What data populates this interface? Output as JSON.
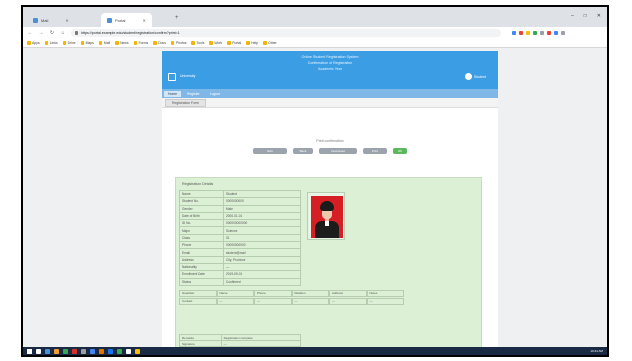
{
  "browser": {
    "tabs": [
      {
        "label": "Mail"
      },
      {
        "label": "Portal",
        "active": true
      }
    ],
    "new_tab_symbol": "+",
    "window_controls": {
      "minimize": "–",
      "maximize": "□",
      "close": "✕"
    },
    "nav": {
      "back": "←",
      "forward": "→",
      "reload": "↻",
      "home": "⌂"
    },
    "address_url": "https://portal.example.edu/student/registration/confirm?print=1",
    "extension_colors": [
      "#4285f4",
      "#ea4335",
      "#fbbc05",
      "#34a853",
      "#9aa0a6",
      "#ea4335",
      "#4285f4",
      "#9aa0a6"
    ],
    "bookmarks": [
      "Apps",
      "Links",
      "Drive",
      "Maps",
      "Mail",
      "News",
      "Forms",
      "Docs",
      "Photos",
      "Tools",
      "Work",
      "Portal",
      "Help",
      "Other"
    ]
  },
  "portal": {
    "banner_lines": [
      "Online Student Registration System",
      "Confirmation of Registration",
      "Academic Year"
    ],
    "org_name": "University",
    "user_label": "Student",
    "nav_tabs": [
      "Home",
      "Register",
      "Logout"
    ],
    "subtab": "Registration Form",
    "notice": "Print confirmation",
    "action_buttons": [
      {
        "label": "Edit",
        "color": "#9ba4ac",
        "width": 34
      },
      {
        "label": "Back",
        "color": "#9ba4ac",
        "width": 20
      },
      {
        "label": "Download",
        "color": "#9ba4ac",
        "width": 38
      },
      {
        "label": "Print",
        "color": "#9ba4ac",
        "width": 24
      },
      {
        "label": "OK",
        "color": "#5cb85c",
        "width": 14
      }
    ],
    "form_title": "Registration Details",
    "info_rows": [
      {
        "k": "Name",
        "v": "Student"
      },
      {
        "k": "Student No.",
        "v": "0000000000"
      },
      {
        "k": "Gender",
        "v": "Male"
      },
      {
        "k": "Date of Birth",
        "v": "2000-01-01"
      },
      {
        "k": "ID No.",
        "v": "000000000000"
      },
      {
        "k": "Major",
        "v": "Science"
      },
      {
        "k": "Class",
        "v": "01"
      },
      {
        "k": "Phone",
        "v": "00000000000"
      },
      {
        "k": "Email",
        "v": "student@mail"
      },
      {
        "k": "Address",
        "v": "City, Province"
      },
      {
        "k": "Nationality",
        "v": "—"
      },
      {
        "k": "Enrollment Date",
        "v": "2019-09-01"
      },
      {
        "k": "Status",
        "v": "Confirmed"
      }
    ],
    "wide_rows": [
      [
        "Guardian",
        "Name",
        "Phone",
        "Relation",
        "Address",
        "Notes"
      ],
      [
        "Contact",
        "—",
        "—",
        "—",
        "—",
        "—"
      ]
    ],
    "bottom_rows": [
      {
        "k": "Remarks",
        "v": "Registration complete"
      },
      {
        "k": "Signature",
        "v": "—"
      }
    ]
  },
  "taskbar": {
    "icon_colors": [
      "#ffffff",
      "#4a90d9",
      "#f0a030",
      "#3aa757",
      "#d93025",
      "#9aa0a6",
      "#4285f4",
      "#e37400",
      "#1a73e8",
      "#34a853",
      "#ffffff",
      "#fbbc05"
    ],
    "clock": "10:24 AM"
  }
}
